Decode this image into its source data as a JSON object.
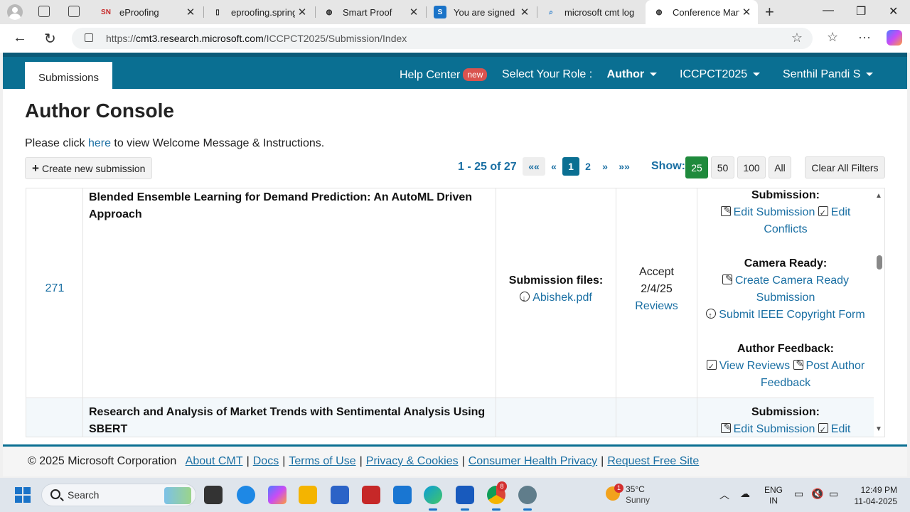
{
  "browser": {
    "tabs": [
      {
        "title": "eProofing",
        "favicon": "SN"
      },
      {
        "title": "eproofing.springe",
        "favicon": "doc"
      },
      {
        "title": "Smart Proof",
        "favicon": "globe"
      },
      {
        "title": "You are signed in",
        "favicon": "S"
      },
      {
        "title": "microsoft cmt log",
        "favicon": "search"
      },
      {
        "title": "Conference Mana",
        "favicon": "globe"
      }
    ],
    "url_prefix": "https://",
    "url_domain": "cmt3.research.microsoft.com",
    "url_path": "/ICCPCT2025/Submission/Index"
  },
  "topbar": {
    "submissions_tab": "Submissions",
    "help_center": "Help Center",
    "new_badge": "new",
    "role_label": "Select Your Role :",
    "role_value": "Author",
    "conference": "ICCPCT2025",
    "user": "Senthil Pandi S"
  },
  "console": {
    "title": "Author Console",
    "welcome_pre": "Please click",
    "welcome_link": "here",
    "welcome_post": "to view Welcome Message & Instructions.",
    "create_button": "Create new submission"
  },
  "pagination": {
    "range": "1 - 25 of 27",
    "first": "««",
    "prev": "«",
    "pages": [
      "1",
      "2"
    ],
    "next": "»",
    "last": "»»",
    "show_label": "Show:",
    "show_options": [
      "25",
      "50",
      "100",
      "All"
    ],
    "clear_filters": "Clear All Filters"
  },
  "submissions": [
    {
      "id": "271",
      "title": "Blended Ensemble Learning for Demand Prediction: An AutoML Driven Approach",
      "files_label": "Submission files:",
      "file": "Abishek.pdf",
      "status": "Accept",
      "date": "2/4/25",
      "reviews": "Reviews",
      "actions": {
        "submission_heading": "Submission:",
        "edit_submission": "Edit Submission",
        "edit_conflicts": "Edit Conflicts",
        "camera_heading": "Camera Ready:",
        "create_camera": "Create Camera Ready Submission",
        "copyright": "Submit IEEE Copyright Form",
        "feedback_heading": "Author Feedback:",
        "view_reviews": "View Reviews",
        "post_feedback": "Post Author Feedback"
      }
    },
    {
      "id": "",
      "title": "Research and Analysis of Market Trends with Sentimental Analysis Using SBERT",
      "actions": {
        "submission_heading": "Submission:",
        "edit_submission": "Edit Submission",
        "edit_conflicts": "Edit"
      }
    }
  ],
  "footer": {
    "copyright": "© 2025 Microsoft Corporation",
    "links": [
      "About CMT",
      "Docs",
      "Terms of Use",
      "Privacy & Cookies",
      "Consumer Health Privacy",
      "Request Free Site"
    ]
  },
  "taskbar": {
    "search_placeholder": "Search",
    "weather_temp": "35°C",
    "weather_cond": "Sunny",
    "weather_badge": "1",
    "lang_line1": "ENG",
    "lang_line2": "IN",
    "time": "12:49 PM",
    "date": "11-04-2025",
    "chrome_badge": "8"
  },
  "colors": {
    "brand": "#0a6f92",
    "link": "#1a6fa3",
    "selected_show": "#1f8a3c",
    "new_badge": "#d9534f"
  }
}
